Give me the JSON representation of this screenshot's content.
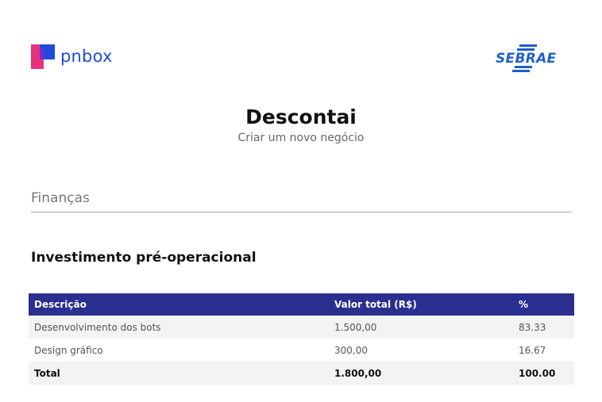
{
  "header": {
    "brand_left": "pnbox",
    "brand_right": "SEBRAE",
    "brand_color": "#1f4bd8"
  },
  "document": {
    "title": "Descontai",
    "subtitle": "Criar um novo negócio"
  },
  "section": {
    "label": "Finanças"
  },
  "table": {
    "heading": "Investimento pré-operacional",
    "header_color": "#2b2f8f",
    "columns": [
      "Descrição",
      "Valor total (R$)",
      "%"
    ],
    "rows": [
      [
        "Desenvolvimento dos bots",
        "1.500,00",
        "83.33"
      ],
      [
        "Design gráfico",
        "300,00",
        "16.67"
      ]
    ],
    "total": [
      "Total",
      "1.800,00",
      "100.00"
    ]
  }
}
